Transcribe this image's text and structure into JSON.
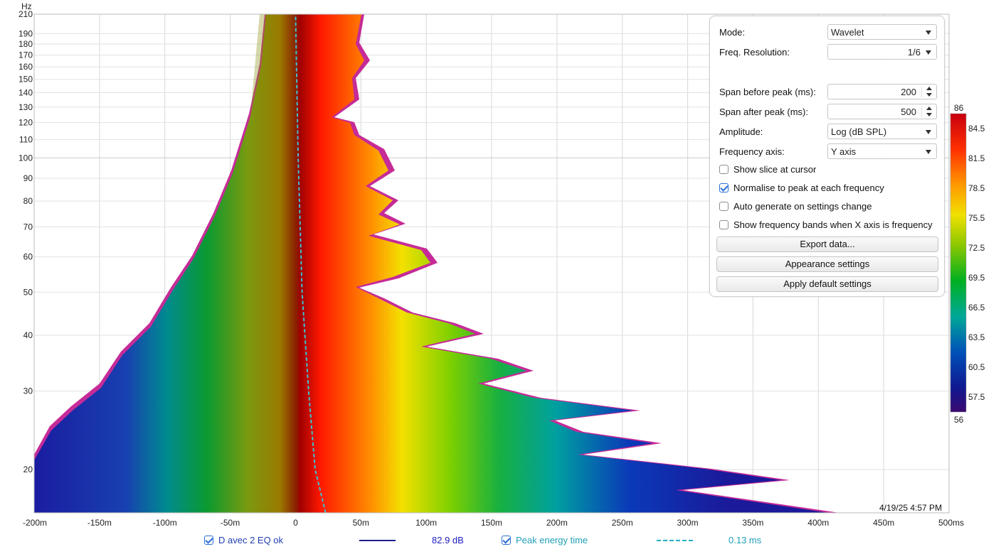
{
  "chart_data": {
    "type": "heatmap",
    "title": "",
    "xlabel": "",
    "ylabel": "Hz",
    "x_unit": "ms",
    "xlim": [
      -200,
      500
    ],
    "ylim": [
      16,
      210
    ],
    "y_scale": "log",
    "x_ticks": [
      "-200m",
      "-150m",
      "-100m",
      "-50m",
      "0",
      "50m",
      "100m",
      "150m",
      "200m",
      "250m",
      "300m",
      "350m",
      "400m",
      "450m",
      "500ms"
    ],
    "x_tick_values": [
      -200,
      -150,
      -100,
      -50,
      0,
      50,
      100,
      150,
      200,
      250,
      300,
      350,
      400,
      450,
      500
    ],
    "y_ticks": [
      20,
      30,
      40,
      50,
      60,
      70,
      80,
      90,
      100,
      110,
      120,
      130,
      140,
      150,
      160,
      170,
      180,
      190,
      210
    ],
    "colorbar": {
      "min": 56,
      "max": 86,
      "ticks": [
        "84.5",
        "81.5",
        "78.5",
        "75.5",
        "72.5",
        "69.5",
        "66.5",
        "63.5",
        "60.5",
        "57.5"
      ],
      "unit": "dB SPL"
    },
    "peak_energy_curve": [
      [
        23,
        16
      ],
      [
        15,
        20
      ],
      [
        10,
        30
      ],
      [
        5,
        50
      ],
      [
        2,
        100
      ],
      [
        0,
        210
      ]
    ],
    "decay_extent": [
      [
        410,
        16
      ],
      [
        380,
        19
      ],
      [
        280,
        23
      ],
      [
        265,
        28
      ],
      [
        185,
        33
      ],
      [
        145,
        40
      ],
      [
        105,
        55
      ],
      [
        80,
        70
      ],
      [
        55,
        95
      ],
      [
        45,
        150
      ],
      [
        40,
        200
      ]
    ],
    "onset_extent": [
      [
        -200,
        16
      ],
      [
        -195,
        22
      ],
      [
        -175,
        30
      ],
      [
        -110,
        45
      ],
      [
        -80,
        70
      ],
      [
        -45,
        120
      ],
      [
        -25,
        210
      ]
    ],
    "grid": true,
    "legend_position": "bottom"
  },
  "panel": {
    "mode_label": "Mode:",
    "mode_value": "Wavelet",
    "freqres_label": "Freq. Resolution:",
    "freqres_value": "1/6",
    "span_before_label": "Span before peak (ms):",
    "span_before_value": "200",
    "span_after_label": "Span after peak (ms):",
    "span_after_value": "500",
    "amplitude_label": "Amplitude:",
    "amplitude_value": "Log (dB SPL)",
    "freqaxis_label": "Frequency axis:",
    "freqaxis_value": "Y axis",
    "checkboxes": [
      {
        "label": "Show slice at cursor",
        "checked": false
      },
      {
        "label": "Normalise to peak at each frequency",
        "checked": true
      },
      {
        "label": "Auto generate on settings change",
        "checked": false
      },
      {
        "label": "Show frequency bands when X axis is frequency",
        "checked": false
      }
    ],
    "export_label": "Export data...",
    "appearance_label": "Appearance settings",
    "defaults_label": "Apply default settings"
  },
  "scale": {
    "top": "86",
    "bottom": "56"
  },
  "timestamp": "4/19/25 4:57 PM",
  "legend": {
    "measurement_name": "D avec 2 EQ ok",
    "measurement_value": "82.9 dB",
    "measurement_color": "#1c1c8c",
    "peak_name": "Peak energy time",
    "peak_value": "0.13 ms",
    "peak_color": "#20b0c0"
  },
  "colors": {
    "accent": "#2b6fd4"
  }
}
